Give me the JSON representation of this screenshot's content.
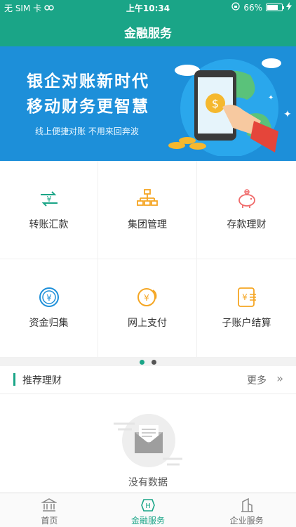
{
  "status_bar": {
    "carrier": "无 SIM 卡",
    "time": "上午10:34",
    "battery": "66%",
    "battery_level": 0.66
  },
  "nav": {
    "title": "金融服务"
  },
  "banner": {
    "line1": "银企对账新时代",
    "line2": "移动财务更智慧",
    "subtitle": "线上便捷对账 不用来回奔波"
  },
  "services": [
    {
      "label": "转账汇款",
      "icon": "transfer-yuan-icon"
    },
    {
      "label": "集团管理",
      "icon": "org-chart-icon"
    },
    {
      "label": "存款理财",
      "icon": "piggy-bank-icon"
    },
    {
      "label": "资金归集",
      "icon": "yuan-coin-icon"
    },
    {
      "label": "网上支付",
      "icon": "online-pay-icon"
    },
    {
      "label": "子账户结算",
      "icon": "sub-account-icon"
    }
  ],
  "pager": {
    "pages": 2,
    "active": 0
  },
  "recommend": {
    "title": "推荐理财",
    "more": "更多",
    "empty_text": "没有数据"
  },
  "tabbar": [
    {
      "label": "首页",
      "icon": "bank-icon",
      "active": false
    },
    {
      "label": "金融服务",
      "icon": "finance-icon",
      "active": true
    },
    {
      "label": "企业服务",
      "icon": "building-icon",
      "active": false
    }
  ],
  "colors": {
    "primary": "#1aa587",
    "banner": "#1d8fd9",
    "icon_orange": "#f5a623",
    "icon_red": "#f06a6a"
  }
}
